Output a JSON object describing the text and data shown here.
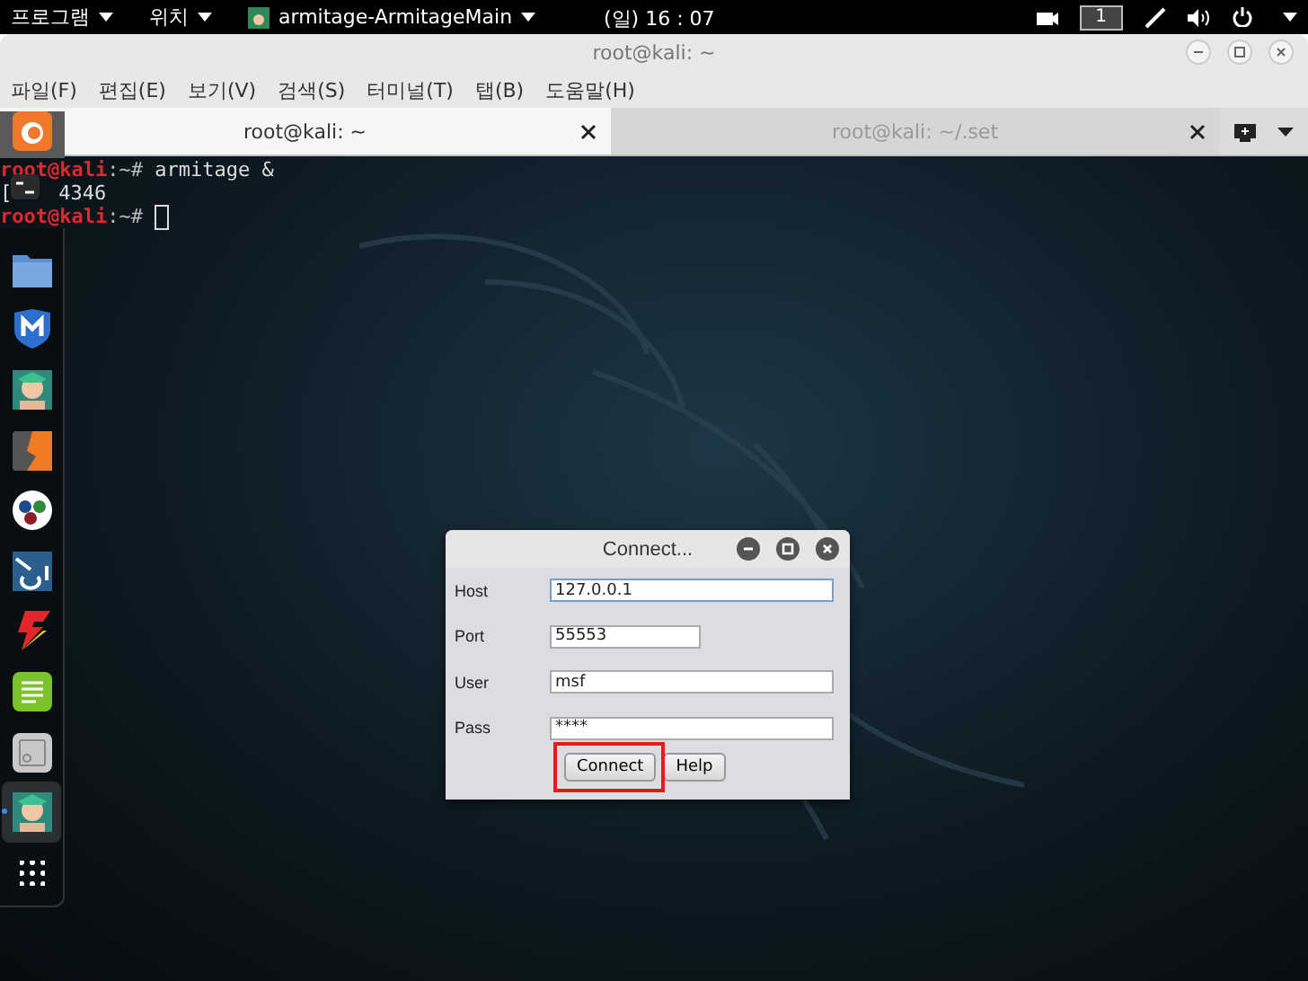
{
  "top_bar": {
    "menus": [
      {
        "label": "프로그램"
      },
      {
        "label": "위치"
      },
      {
        "label": "armitage-ArmitageMain"
      }
    ],
    "clock": "(일) 16 : 07",
    "workspace": "1"
  },
  "window": {
    "title": "root@kali: ~",
    "menu": [
      "파일(F)",
      "편집(E)",
      "보기(V)",
      "검색(S)",
      "터미널(T)",
      "탭(B)",
      "도움말(H)"
    ],
    "tabs": [
      {
        "label": "root@kali: ~",
        "selected": true
      },
      {
        "label": "root@kali: ~/.set",
        "selected": false
      }
    ]
  },
  "terminal": {
    "lines": [
      [
        {
          "kind": "user",
          "text": "root@kali"
        },
        {
          "kind": "path",
          "text": ":~# "
        },
        {
          "kind": "text",
          "text": "armitage &"
        }
      ],
      [
        {
          "kind": "text",
          "text": "["
        },
        {
          "kind": "gap"
        },
        {
          "kind": "text",
          "text": "4346"
        }
      ],
      [
        {
          "kind": "user",
          "text": "root@kali"
        },
        {
          "kind": "path",
          "text": ":~# "
        },
        {
          "kind": "cursor"
        }
      ]
    ]
  },
  "dock": [
    {
      "kind": "fox",
      "selected": false
    },
    {
      "kind": "terminal",
      "selected": false
    },
    {
      "kind": "folder",
      "selected": false
    },
    {
      "kind": "shield",
      "selected": false
    },
    {
      "kind": "avatar",
      "selected": false
    },
    {
      "kind": "split",
      "selected": false
    },
    {
      "kind": "dots",
      "selected": false
    },
    {
      "kind": "broken",
      "selected": false
    },
    {
      "kind": "bolt",
      "selected": false
    },
    {
      "kind": "notes",
      "selected": false
    },
    {
      "kind": "panel",
      "selected": false
    },
    {
      "kind": "avatar",
      "selected": true
    },
    {
      "kind": "grid",
      "selected": false
    }
  ],
  "dialog": {
    "title": "Connect...",
    "fields": [
      {
        "label": "Host",
        "value": "127.0.0.1",
        "focused": true,
        "short": false
      },
      {
        "label": "Port",
        "value": "55553",
        "focused": false,
        "short": true
      },
      {
        "label": "User",
        "value": "msf",
        "focused": false,
        "short": false
      },
      {
        "label": "Pass",
        "value": "****",
        "focused": false,
        "short": false
      }
    ],
    "buttons": [
      {
        "label": "Connect",
        "highlighted": true
      },
      {
        "label": "Help",
        "highlighted": false
      }
    ]
  }
}
